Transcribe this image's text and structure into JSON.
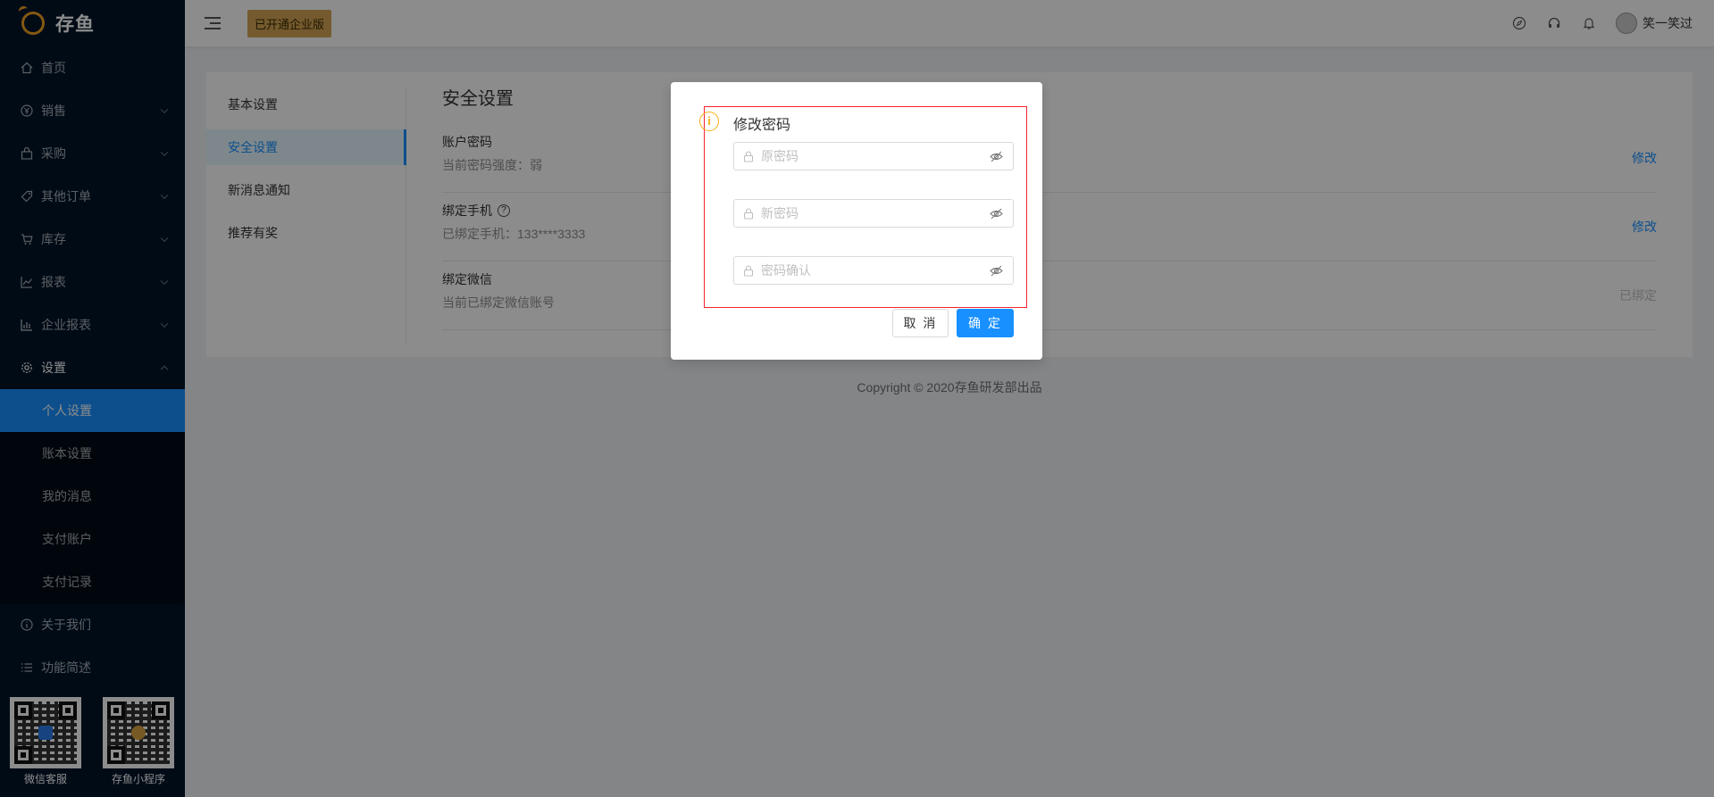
{
  "brand": {
    "name": "存鱼"
  },
  "header": {
    "enterprise_badge": "已开通企业版",
    "user_name": "笑一笑过",
    "icons": [
      "compass-icon",
      "headset-icon",
      "bell-icon"
    ]
  },
  "sidebar": {
    "items": [
      {
        "label": "首页",
        "icon": "home-icon"
      },
      {
        "label": "销售",
        "icon": "yen-icon"
      },
      {
        "label": "采购",
        "icon": "bag-icon"
      },
      {
        "label": "其他订单",
        "icon": "tag-icon"
      },
      {
        "label": "库存",
        "icon": "cart-icon"
      },
      {
        "label": "报表",
        "icon": "line-chart-icon"
      },
      {
        "label": "企业报表",
        "icon": "bar-chart-icon"
      },
      {
        "label": "设置",
        "icon": "gear-icon"
      }
    ],
    "settings_sub": [
      {
        "label": "个人设置",
        "active": true
      },
      {
        "label": "账本设置"
      },
      {
        "label": "我的消息"
      },
      {
        "label": "支付账户"
      },
      {
        "label": "支付记录"
      }
    ],
    "bottom_items": [
      {
        "label": "关于我们",
        "icon": "info-icon"
      },
      {
        "label": "功能简述",
        "icon": "list-icon"
      }
    ],
    "qr": [
      {
        "label": "微信客服",
        "center_color": "#2b7de9"
      },
      {
        "label": "存鱼小程序",
        "center_color": "#d9a441"
      }
    ]
  },
  "settings": {
    "nav": [
      "基本设置",
      "安全设置",
      "新消息通知",
      "推荐有奖"
    ],
    "title": "安全设置",
    "rows": [
      {
        "label": "账户密码",
        "desc": "当前密码强度：弱",
        "action": "修改"
      },
      {
        "label": "绑定手机",
        "desc": "已绑定手机：133****3333",
        "action": "修改"
      },
      {
        "label": "绑定微信",
        "desc": "当前已绑定微信账号",
        "action": "已绑定"
      }
    ]
  },
  "footer": {
    "text": "Copyright © 2020存鱼研发部出品"
  },
  "modal": {
    "title": "修改密码",
    "old_placeholder": "原密码",
    "new_placeholder": "新密码",
    "confirm_placeholder": "密码确认",
    "cancel_label": "取 消",
    "ok_label": "确 定"
  },
  "colors": {
    "primary": "#1890ff",
    "sidebar_bg": "#001529",
    "warning": "#faad14",
    "highlight": "#f5222d",
    "badge": "#d4a555"
  }
}
